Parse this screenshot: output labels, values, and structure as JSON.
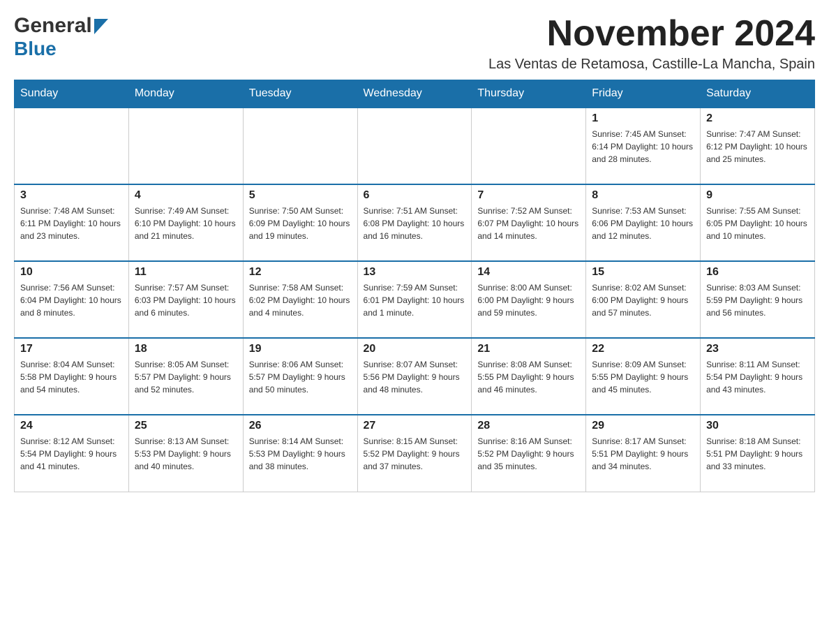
{
  "header": {
    "logo_general": "General",
    "logo_blue": "Blue",
    "main_title": "November 2024",
    "subtitle": "Las Ventas de Retamosa, Castille-La Mancha, Spain"
  },
  "days_of_week": [
    "Sunday",
    "Monday",
    "Tuesday",
    "Wednesday",
    "Thursday",
    "Friday",
    "Saturday"
  ],
  "weeks": [
    {
      "days": [
        {
          "num": "",
          "info": ""
        },
        {
          "num": "",
          "info": ""
        },
        {
          "num": "",
          "info": ""
        },
        {
          "num": "",
          "info": ""
        },
        {
          "num": "",
          "info": ""
        },
        {
          "num": "1",
          "info": "Sunrise: 7:45 AM\nSunset: 6:14 PM\nDaylight: 10 hours and 28 minutes."
        },
        {
          "num": "2",
          "info": "Sunrise: 7:47 AM\nSunset: 6:12 PM\nDaylight: 10 hours and 25 minutes."
        }
      ]
    },
    {
      "days": [
        {
          "num": "3",
          "info": "Sunrise: 7:48 AM\nSunset: 6:11 PM\nDaylight: 10 hours and 23 minutes."
        },
        {
          "num": "4",
          "info": "Sunrise: 7:49 AM\nSunset: 6:10 PM\nDaylight: 10 hours and 21 minutes."
        },
        {
          "num": "5",
          "info": "Sunrise: 7:50 AM\nSunset: 6:09 PM\nDaylight: 10 hours and 19 minutes."
        },
        {
          "num": "6",
          "info": "Sunrise: 7:51 AM\nSunset: 6:08 PM\nDaylight: 10 hours and 16 minutes."
        },
        {
          "num": "7",
          "info": "Sunrise: 7:52 AM\nSunset: 6:07 PM\nDaylight: 10 hours and 14 minutes."
        },
        {
          "num": "8",
          "info": "Sunrise: 7:53 AM\nSunset: 6:06 PM\nDaylight: 10 hours and 12 minutes."
        },
        {
          "num": "9",
          "info": "Sunrise: 7:55 AM\nSunset: 6:05 PM\nDaylight: 10 hours and 10 minutes."
        }
      ]
    },
    {
      "days": [
        {
          "num": "10",
          "info": "Sunrise: 7:56 AM\nSunset: 6:04 PM\nDaylight: 10 hours and 8 minutes."
        },
        {
          "num": "11",
          "info": "Sunrise: 7:57 AM\nSunset: 6:03 PM\nDaylight: 10 hours and 6 minutes."
        },
        {
          "num": "12",
          "info": "Sunrise: 7:58 AM\nSunset: 6:02 PM\nDaylight: 10 hours and 4 minutes."
        },
        {
          "num": "13",
          "info": "Sunrise: 7:59 AM\nSunset: 6:01 PM\nDaylight: 10 hours and 1 minute."
        },
        {
          "num": "14",
          "info": "Sunrise: 8:00 AM\nSunset: 6:00 PM\nDaylight: 9 hours and 59 minutes."
        },
        {
          "num": "15",
          "info": "Sunrise: 8:02 AM\nSunset: 6:00 PM\nDaylight: 9 hours and 57 minutes."
        },
        {
          "num": "16",
          "info": "Sunrise: 8:03 AM\nSunset: 5:59 PM\nDaylight: 9 hours and 56 minutes."
        }
      ]
    },
    {
      "days": [
        {
          "num": "17",
          "info": "Sunrise: 8:04 AM\nSunset: 5:58 PM\nDaylight: 9 hours and 54 minutes."
        },
        {
          "num": "18",
          "info": "Sunrise: 8:05 AM\nSunset: 5:57 PM\nDaylight: 9 hours and 52 minutes."
        },
        {
          "num": "19",
          "info": "Sunrise: 8:06 AM\nSunset: 5:57 PM\nDaylight: 9 hours and 50 minutes."
        },
        {
          "num": "20",
          "info": "Sunrise: 8:07 AM\nSunset: 5:56 PM\nDaylight: 9 hours and 48 minutes."
        },
        {
          "num": "21",
          "info": "Sunrise: 8:08 AM\nSunset: 5:55 PM\nDaylight: 9 hours and 46 minutes."
        },
        {
          "num": "22",
          "info": "Sunrise: 8:09 AM\nSunset: 5:55 PM\nDaylight: 9 hours and 45 minutes."
        },
        {
          "num": "23",
          "info": "Sunrise: 8:11 AM\nSunset: 5:54 PM\nDaylight: 9 hours and 43 minutes."
        }
      ]
    },
    {
      "days": [
        {
          "num": "24",
          "info": "Sunrise: 8:12 AM\nSunset: 5:54 PM\nDaylight: 9 hours and 41 minutes."
        },
        {
          "num": "25",
          "info": "Sunrise: 8:13 AM\nSunset: 5:53 PM\nDaylight: 9 hours and 40 minutes."
        },
        {
          "num": "26",
          "info": "Sunrise: 8:14 AM\nSunset: 5:53 PM\nDaylight: 9 hours and 38 minutes."
        },
        {
          "num": "27",
          "info": "Sunrise: 8:15 AM\nSunset: 5:52 PM\nDaylight: 9 hours and 37 minutes."
        },
        {
          "num": "28",
          "info": "Sunrise: 8:16 AM\nSunset: 5:52 PM\nDaylight: 9 hours and 35 minutes."
        },
        {
          "num": "29",
          "info": "Sunrise: 8:17 AM\nSunset: 5:51 PM\nDaylight: 9 hours and 34 minutes."
        },
        {
          "num": "30",
          "info": "Sunrise: 8:18 AM\nSunset: 5:51 PM\nDaylight: 9 hours and 33 minutes."
        }
      ]
    }
  ]
}
